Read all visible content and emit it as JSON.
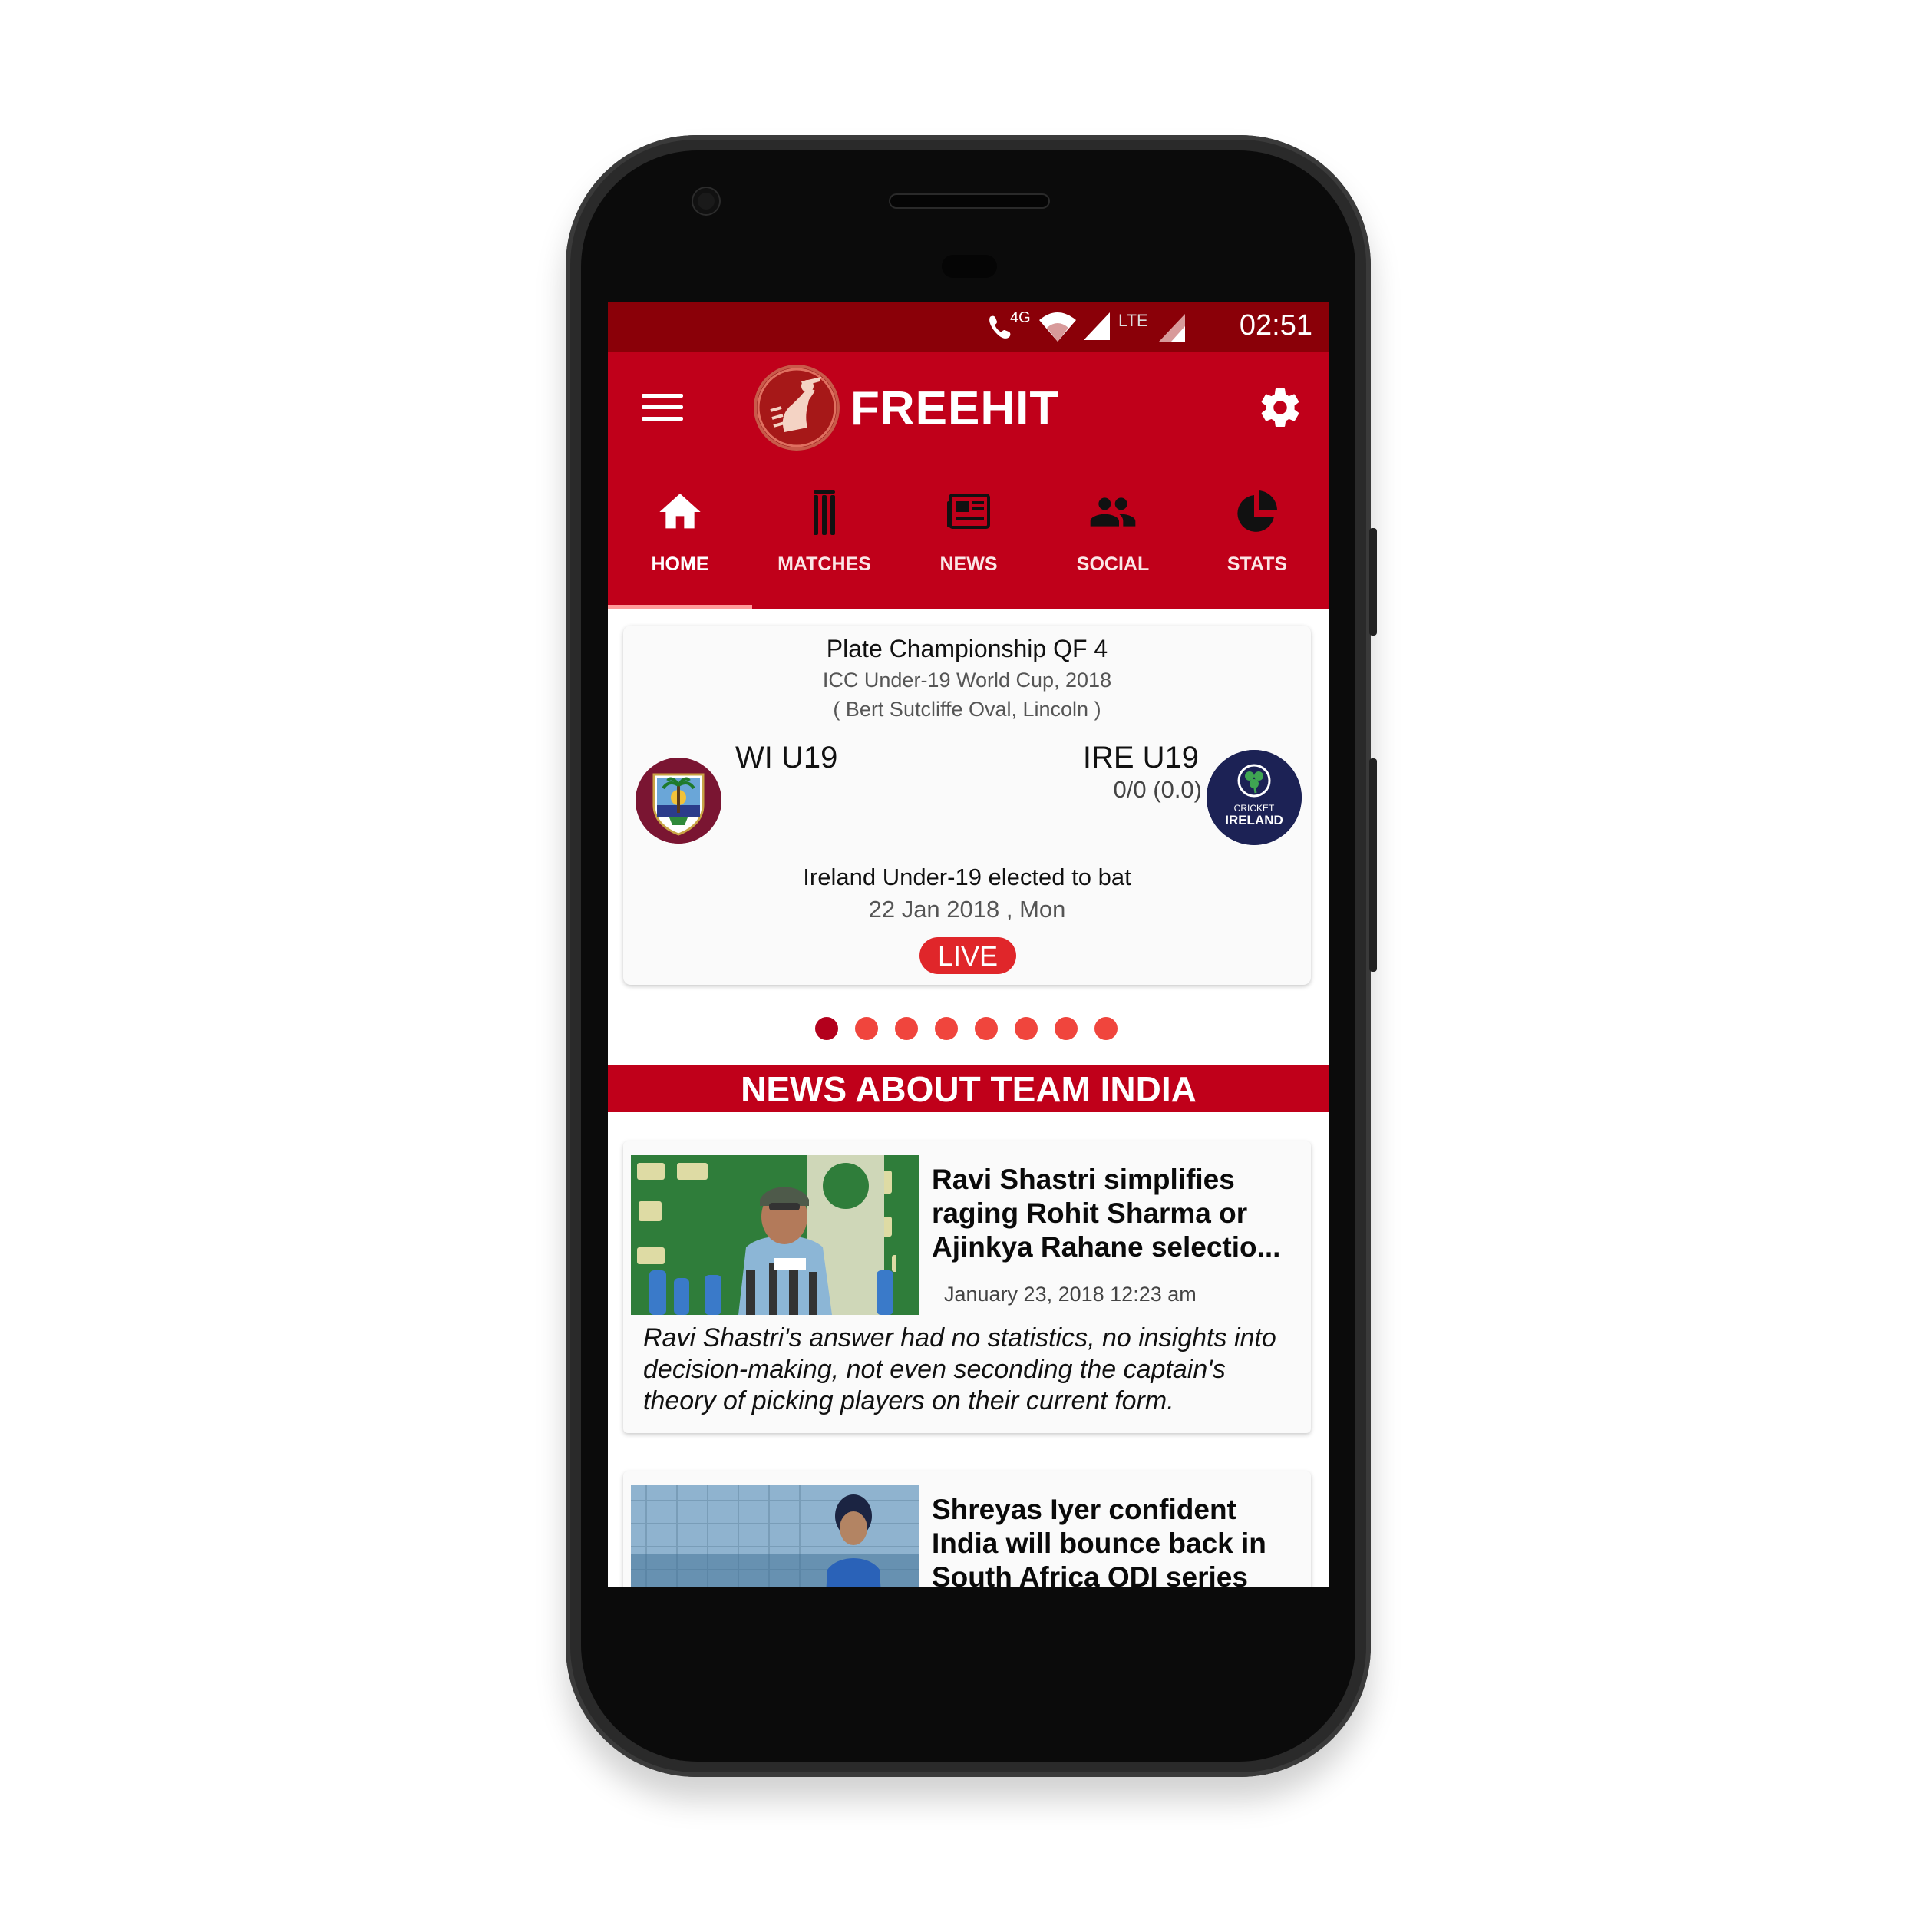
{
  "status_bar": {
    "time": "02:51",
    "network_call_label": "4G",
    "network_label": "LTE"
  },
  "app": {
    "title": "FREEHIT"
  },
  "colors": {
    "primary": "#c0001a",
    "status_bar": "#8a0008",
    "live": "#e0262a",
    "dot_inactive": "#f0453d",
    "dot_active": "#b3001c"
  },
  "icons": {
    "menu": "hamburger-icon",
    "settings": "gear-icon",
    "home": "home-icon",
    "matches": "stumps-icon",
    "news": "newspaper-icon",
    "social": "people-icon",
    "stats": "pie-chart-icon"
  },
  "tabs": [
    {
      "label": "HOME",
      "active": true
    },
    {
      "label": "MATCHES",
      "active": false
    },
    {
      "label": "NEWS",
      "active": false
    },
    {
      "label": "SOCIAL",
      "active": false
    },
    {
      "label": "STATS",
      "active": false
    }
  ],
  "match": {
    "title": "Plate Championship QF 4",
    "series": "ICC Under-19 World Cup, 2018",
    "venue": "( Bert Sutcliffe Oval, Lincoln )",
    "team_left": {
      "name": "WI U19"
    },
    "team_right": {
      "name": "IRE U19",
      "score": "0/0 (0.0)",
      "logo_text_top": "CRICKET",
      "logo_text_bottom": "IRELAND"
    },
    "toss": "Ireland Under-19 elected to bat",
    "date": "22 Jan 2018 , Mon",
    "status": "LIVE"
  },
  "carousel": {
    "count": 8,
    "active_index": 0
  },
  "news_section": {
    "title": "NEWS ABOUT TEAM INDIA"
  },
  "news": [
    {
      "headline": "Ravi Shastri simplifies raging Rohit Sharma or Ajinkya Rahane selectio...",
      "date": "January 23, 2018 12:23 am",
      "summary": "Ravi Shastri's answer had no statistics, no insights into decision-making, not even seconding the captain's theory of picking players on their current form."
    },
    {
      "headline": "Shreyas Iyer confident India will bounce back in South Africa ODI series",
      "date": "",
      "summary": ""
    }
  ]
}
